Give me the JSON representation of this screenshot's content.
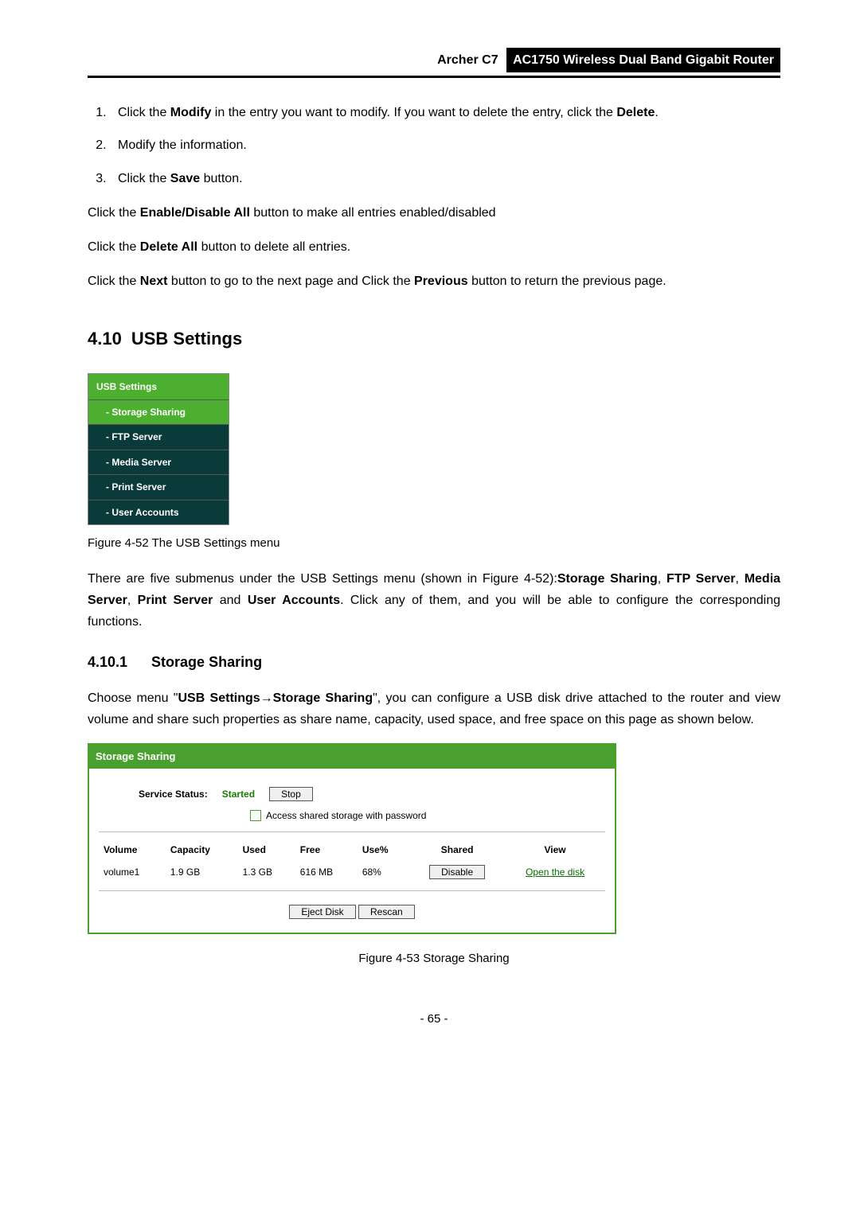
{
  "header": {
    "model": "Archer C7",
    "product_title": "AC1750 Wireless Dual Band Gigabit Router"
  },
  "steps": {
    "s1_a": "Click the ",
    "s1_b": "Modify",
    "s1_c": " in the entry you want to modify. If you want to delete the entry, click the ",
    "s1_d": "Delete",
    "s1_e": ".",
    "s2": "Modify the information.",
    "s3_a": "Click the ",
    "s3_b": "Save",
    "s3_c": " button."
  },
  "paras": {
    "p1_a": "Click the ",
    "p1_b": "Enable/Disable All",
    "p1_c": " button to make all entries enabled/disabled",
    "p2_a": "Click the ",
    "p2_b": "Delete All",
    "p2_c": " button to delete all entries.",
    "p3_a": "Click the ",
    "p3_b": "Next",
    "p3_c": " button to go to the next page and Click the ",
    "p3_d": "Previous",
    "p3_e": " button to return the previous page."
  },
  "section_4_10": {
    "num": "4.10",
    "title": "USB Settings"
  },
  "nav": {
    "title": "USB Settings",
    "items": [
      "- Storage Sharing",
      "- FTP Server",
      "- Media Server",
      "- Print Server",
      "- User Accounts"
    ]
  },
  "fig52_caption": "Figure 4-52 The USB Settings menu",
  "para_submenus": {
    "a": "There are five submenus under the USB Settings menu (shown in Figure 4-52):",
    "b": "Storage Sharing",
    "c": ", ",
    "d": "FTP Server",
    "e": ", ",
    "f": "Media Server",
    "g": ", ",
    "h": "Print Server",
    "i": " and ",
    "j": "User Accounts",
    "k": ". Click any of them, and you will be able to configure the corresponding functions."
  },
  "subsection_4_10_1": {
    "num": "4.10.1",
    "title": "Storage Sharing"
  },
  "para_choose": {
    "a": "Choose menu \"",
    "b": "USB Settings",
    "arrow": "→",
    "c": "Storage Sharing",
    "d": "\", you can configure a USB disk drive attached to the router and view volume and share such properties as share name, capacity, used space, and free space on this page as shown below."
  },
  "panel": {
    "title": "Storage Sharing",
    "service_label": "Service Status:",
    "service_status": "Started",
    "stop_btn": "Stop",
    "checkbox_label": "Access shared storage with password",
    "headers": {
      "volume": "Volume",
      "capacity": "Capacity",
      "used": "Used",
      "free": "Free",
      "usepct": "Use%",
      "shared": "Shared",
      "view": "View"
    },
    "row": {
      "volume": "volume1",
      "capacity": "1.9 GB",
      "used": "1.3 GB",
      "free": "616 MB",
      "usepct": "68%",
      "shared_btn": "Disable",
      "view_link": "Open the disk"
    },
    "eject_btn": "Eject Disk",
    "rescan_btn": "Rescan"
  },
  "fig53_caption": "Figure 4-53 Storage Sharing",
  "page_number": "- 65 -"
}
